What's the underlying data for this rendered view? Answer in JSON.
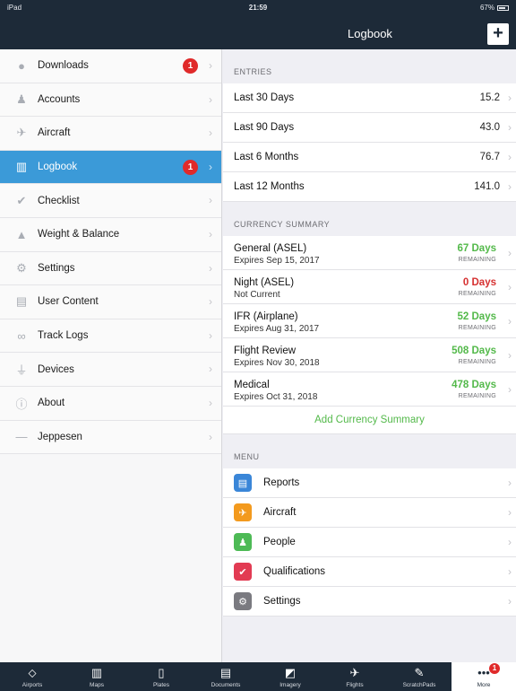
{
  "status_bar": {
    "device": "iPad",
    "time": "21:59",
    "battery": "67%"
  },
  "nav": {
    "title": "Logbook",
    "add_label": "+"
  },
  "sidebar": {
    "items": [
      {
        "label": "Downloads",
        "icon": "circle-icon",
        "badge": "1"
      },
      {
        "label": "Accounts",
        "icon": "person-icon"
      },
      {
        "label": "Aircraft",
        "icon": "airplane-icon"
      },
      {
        "label": "Logbook",
        "icon": "book-icon",
        "badge": "1",
        "active": true
      },
      {
        "label": "Checklist",
        "icon": "check-icon"
      },
      {
        "label": "Weight & Balance",
        "icon": "weight-icon"
      },
      {
        "label": "Settings",
        "icon": "gear-icon"
      },
      {
        "label": "User Content",
        "icon": "document-icon"
      },
      {
        "label": "Track Logs",
        "icon": "track-icon"
      },
      {
        "label": "Devices",
        "icon": "plug-icon"
      },
      {
        "label": "About",
        "icon": "info-icon"
      },
      {
        "label": "Jeppesen",
        "icon": "jeppesen-icon"
      }
    ]
  },
  "entries": {
    "header": "ENTRIES",
    "rows": [
      {
        "label": "Last 30 Days",
        "value": "15.2"
      },
      {
        "label": "Last 90 Days",
        "value": "43.0"
      },
      {
        "label": "Last 6 Months",
        "value": "76.7"
      },
      {
        "label": "Last 12 Months",
        "value": "141.0"
      }
    ]
  },
  "currency": {
    "header": "CURRENCY SUMMARY",
    "remaining_label": "REMAINING",
    "rows": [
      {
        "title": "General (ASEL)",
        "subtitle": "Expires Sep 15, 2017",
        "days": "67 Days",
        "status": "green"
      },
      {
        "title": "Night (ASEL)",
        "subtitle": "Not Current",
        "days": "0 Days",
        "status": "red"
      },
      {
        "title": "IFR (Airplane)",
        "subtitle": "Expires Aug 31, 2017",
        "days": "52 Days",
        "status": "green"
      },
      {
        "title": "Flight Review",
        "subtitle": "Expires Nov 30, 2018",
        "days": "508 Days",
        "status": "green"
      },
      {
        "title": "Medical",
        "subtitle": "Expires Oct 31, 2018",
        "days": "478 Days",
        "status": "green"
      }
    ],
    "add_label": "Add Currency Summary"
  },
  "menu": {
    "header": "MENU",
    "items": [
      {
        "label": "Reports",
        "icon": "reports-icon",
        "color": "#3a86d8",
        "glyph": "▤"
      },
      {
        "label": "Aircraft",
        "icon": "aircraft-icon",
        "color": "#f39a1e",
        "glyph": "✈"
      },
      {
        "label": "People",
        "icon": "people-icon",
        "color": "#4dba55",
        "glyph": "♟"
      },
      {
        "label": "Qualifications",
        "icon": "qualifications-icon",
        "color": "#e23b53",
        "glyph": "✔"
      },
      {
        "label": "Settings",
        "icon": "settings-icon",
        "color": "#7a7a80",
        "glyph": "⚙"
      }
    ]
  },
  "tabbar": {
    "tabs": [
      {
        "label": "Airports",
        "icon": "airport-icon",
        "glyph": "⬦"
      },
      {
        "label": "Maps",
        "icon": "map-icon",
        "glyph": "▥"
      },
      {
        "label": "Plates",
        "icon": "plates-icon",
        "glyph": "▯"
      },
      {
        "label": "Documents",
        "icon": "documents-icon",
        "glyph": "▤"
      },
      {
        "label": "Imagery",
        "icon": "imagery-icon",
        "glyph": "◩"
      },
      {
        "label": "Flights",
        "icon": "flights-icon",
        "glyph": "✈"
      },
      {
        "label": "ScratchPads",
        "icon": "pen-icon",
        "glyph": "✎"
      },
      {
        "label": "More",
        "icon": "more-icon",
        "glyph": "•••",
        "badge": "1",
        "active": true
      }
    ]
  }
}
